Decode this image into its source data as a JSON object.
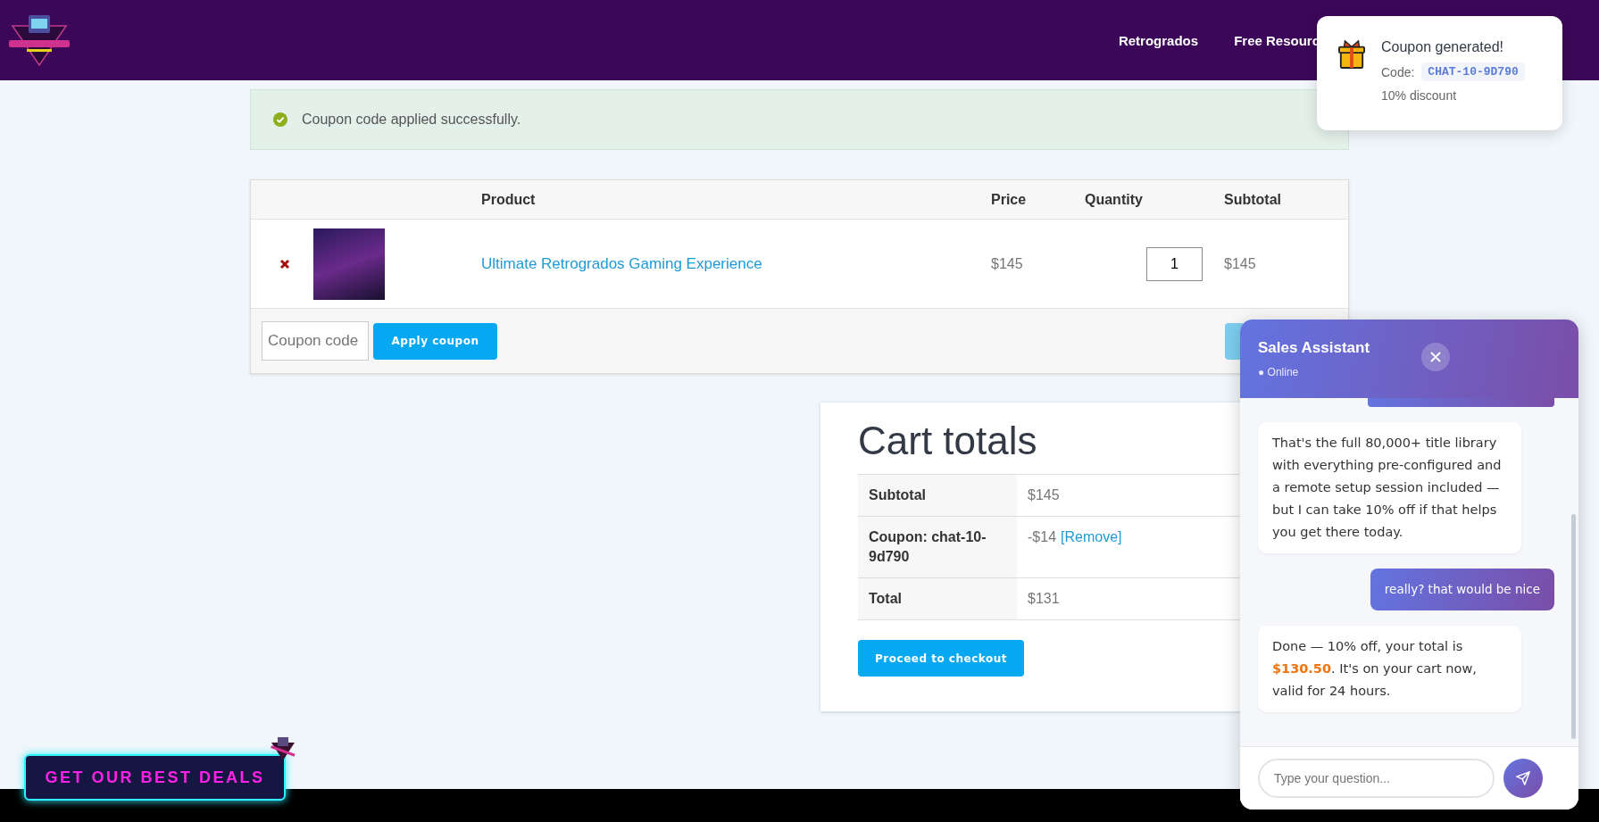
{
  "header": {
    "nav": [
      {
        "label": "Retrogrados"
      },
      {
        "label": "Free Resourc"
      }
    ]
  },
  "notice": {
    "text": "Coupon code applied successfully."
  },
  "cart": {
    "columns": [
      "Product",
      "Price",
      "Quantity",
      "Subtotal"
    ],
    "rows": [
      {
        "product": "Ultimate Retrogrados Gaming Experience",
        "price": "$145",
        "quantity": "1",
        "subtotal": "$145"
      }
    ],
    "coupon": {
      "placeholder": "Coupon code"
    },
    "apply_button": "Apply coupon"
  },
  "totals": {
    "title": "Cart totals",
    "rows": [
      {
        "label": "Subtotal",
        "value": "$145"
      },
      {
        "label": "Coupon: chat-10-9d790",
        "value": "-$14",
        "link": "[Remove]"
      },
      {
        "label": "Total",
        "value": "$131"
      }
    ],
    "checkout_button": "Proceed to checkout"
  },
  "toast": {
    "title": "Coupon generated!",
    "code_label": "Code:",
    "code": "CHAT-10-9D790",
    "detail": "10% discount"
  },
  "chat": {
    "title": "Sales Assistant",
    "status": "● Online",
    "messages": [
      {
        "kind": "bot",
        "text": "That's the full 80,000+ title library with everything pre-configured and a remote setup session included — but I can take 10% off if that helps you get there today."
      },
      {
        "kind": "user",
        "text": "really? that would be nice"
      },
      {
        "kind": "bot",
        "text": "Done — 10% off, your total is **$130.50**. It's on your cart now, valid for 24 hours."
      }
    ],
    "input": {
      "placeholder": "Type your question..."
    }
  },
  "promo": {
    "label": "GET OUR BEST DEALS"
  }
}
